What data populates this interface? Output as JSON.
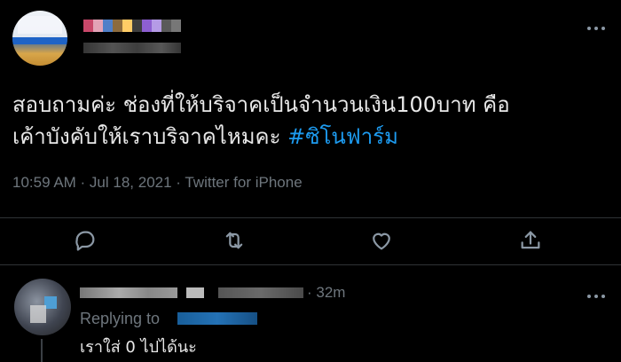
{
  "tweet": {
    "text_line1": "สอบถามค่ะ ช่องที่ให้บริจาคเป็นจำนวนเงิน100บาท คือ",
    "text_line2_plain": "เค้าบังคับให้เราบริจาคไหมคะ ",
    "hashtag": "#ซิโนฟาร์ม",
    "timestamp": "10:59 AM · Jul 18, 2021 · Twitter for iPhone"
  },
  "reply": {
    "time": "· 32m",
    "replying_to_label": "Replying to",
    "text": "เราใส่ 0 ไปได้นะ"
  },
  "icons": {
    "reply": "reply-icon",
    "retweet": "retweet-icon",
    "like": "heart-icon",
    "share": "share-icon",
    "more": "more-horizontal-icon"
  },
  "colors": {
    "background": "#000000",
    "text": "#e8e8e8",
    "muted": "#6e767d",
    "link": "#1d9bf0",
    "divider": "#2f3336"
  }
}
